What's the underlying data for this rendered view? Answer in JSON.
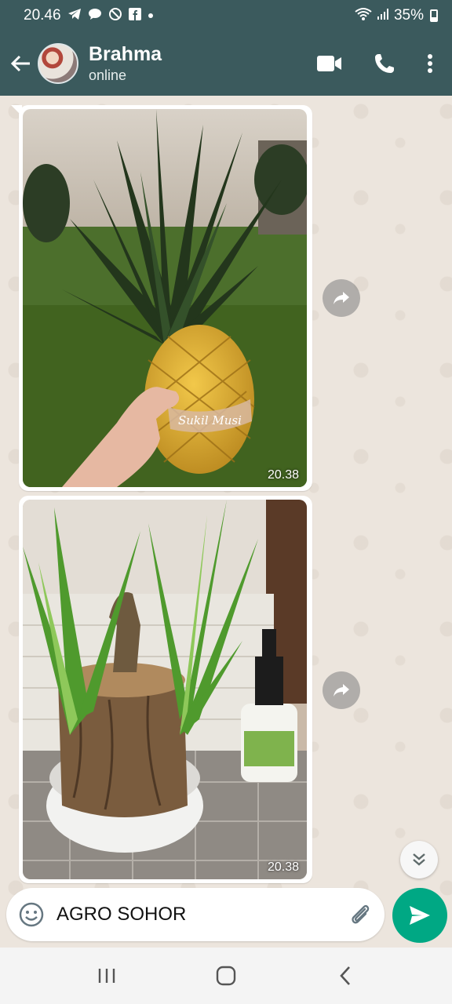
{
  "status_bar": {
    "time": "20.46",
    "battery": "35%",
    "notification_icons": [
      "telegram-icon",
      "chat-bubble-icon",
      "blocked-icon",
      "facebook-icon",
      "dot-icon"
    ],
    "system_icons": [
      "wifi-icon",
      "signal-icon",
      "battery-icon"
    ]
  },
  "header": {
    "contact_name": "Brahma",
    "contact_status": "online",
    "actions": [
      "video-call-icon",
      "voice-call-icon",
      "more-options-icon"
    ]
  },
  "messages": [
    {
      "type": "image",
      "subject": "dracaena plant in golden pineapple-shaped pot held in hand",
      "pot_text": "Sukil Musi",
      "time": "20.38"
    },
    {
      "type": "image",
      "subject": "dracaena plant in tree-stump pot with Groot figurine, spray bottle",
      "time": "20.38"
    }
  ],
  "input": {
    "value": "AGRO SOHOR"
  },
  "colors": {
    "header_bg": "#3b5a5d",
    "send_button": "#00a884",
    "chat_bg": "#ece5dd"
  }
}
